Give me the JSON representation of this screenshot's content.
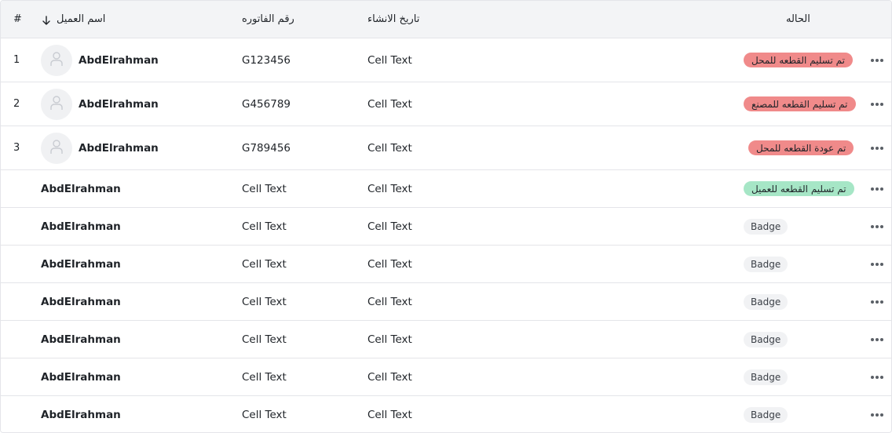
{
  "header": {
    "num": "#",
    "customer_name": "اسم العميل",
    "invoice_number": "رقم الفاتوره",
    "created_date": "تاريخ الانشاء",
    "status": "الحاله"
  },
  "colors": {
    "status_red": "#f08a8a",
    "status_green": "#a6e6c6",
    "header_bg": "#f3f4f6",
    "badge_bg": "#f1f2f4"
  },
  "rows": [
    {
      "num": "1",
      "name": "AbdElrahman",
      "invoice": "G123456",
      "date": "Cell Text",
      "status": "تم تسليم القطعه للمحل",
      "status_color": "#f08a8a"
    },
    {
      "num": "2",
      "name": "AbdElrahman",
      "invoice": "G456789",
      "date": "Cell Text",
      "status": "تم تسليم القطعه للمصنع",
      "status_color": "#f08a8a"
    },
    {
      "num": "3",
      "name": "AbdElrahman",
      "invoice": "G789456",
      "date": "Cell Text",
      "status": "تم عودة القطعه للمحل",
      "status_color": "#f08a8a"
    },
    {
      "name": "AbdElrahman",
      "invoice": "Cell Text",
      "date": "Cell Text",
      "status": "تم تسليم القطعه للعميل",
      "status_color": "#a6e6c6"
    },
    {
      "name": "AbdElrahman",
      "invoice": "Cell Text",
      "date": "Cell Text",
      "badge": "Badge"
    },
    {
      "name": "AbdElrahman",
      "invoice": "Cell Text",
      "date": "Cell Text",
      "badge": "Badge"
    },
    {
      "name": "AbdElrahman",
      "invoice": "Cell Text",
      "date": "Cell Text",
      "badge": "Badge"
    },
    {
      "name": "AbdElrahman",
      "invoice": "Cell Text",
      "date": "Cell Text",
      "badge": "Badge"
    },
    {
      "name": "AbdElrahman",
      "invoice": "Cell Text",
      "date": "Cell Text",
      "badge": "Badge"
    },
    {
      "name": "AbdElrahman",
      "invoice": "Cell Text",
      "date": "Cell Text",
      "badge": "Badge"
    }
  ]
}
